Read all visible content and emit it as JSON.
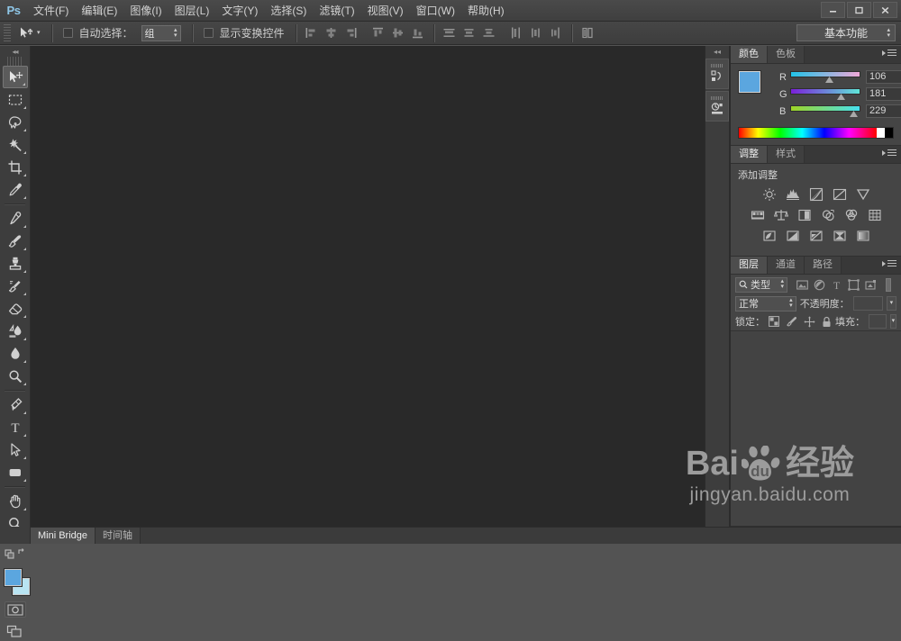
{
  "app": {
    "logo": "Ps",
    "workspace": "基本功能"
  },
  "menubar": {
    "items": [
      {
        "label": "文件(F)",
        "name": "menu-file"
      },
      {
        "label": "编辑(E)",
        "name": "menu-edit"
      },
      {
        "label": "图像(I)",
        "name": "menu-image"
      },
      {
        "label": "图层(L)",
        "name": "menu-layer"
      },
      {
        "label": "文字(Y)",
        "name": "menu-type"
      },
      {
        "label": "选择(S)",
        "name": "menu-select"
      },
      {
        "label": "滤镜(T)",
        "name": "menu-filter"
      },
      {
        "label": "视图(V)",
        "name": "menu-view"
      },
      {
        "label": "窗口(W)",
        "name": "menu-window"
      },
      {
        "label": "帮助(H)",
        "name": "menu-help"
      }
    ],
    "window_controls": {
      "minimize": "—",
      "maximize": "❐",
      "close": "✕"
    }
  },
  "options_bar": {
    "tool_icon": "move-tool-icon",
    "auto_select_label": "自动选择：",
    "auto_select_value": "组",
    "show_transform_label": "显示变换控件",
    "align_group_1": [
      "align-left-edges",
      "align-horizontal-centers",
      "align-right-edges"
    ],
    "align_group_2": [
      "align-top-edges",
      "align-vertical-centers",
      "align-bottom-edges"
    ],
    "distribute_group_1": [
      "distribute-top-edges",
      "distribute-vertical-centers",
      "distribute-bottom-edges"
    ],
    "distribute_group_2": [
      "distribute-left-edges",
      "distribute-horizontal-centers",
      "distribute-right-edges"
    ],
    "auto_align": "auto-align-layers"
  },
  "toolbar": {
    "tools": [
      {
        "name": "move-tool",
        "active": true
      },
      {
        "name": "rectangular-marquee-tool",
        "active": false
      },
      {
        "name": "lasso-tool",
        "active": false
      },
      {
        "name": "magic-wand-tool",
        "active": false
      },
      {
        "name": "crop-tool",
        "active": false
      },
      {
        "name": "eyedropper-tool",
        "active": false
      },
      {
        "name": "spot-healing-brush-tool",
        "active": false
      },
      {
        "name": "brush-tool",
        "active": false
      },
      {
        "name": "clone-stamp-tool",
        "active": false
      },
      {
        "name": "history-brush-tool",
        "active": false
      },
      {
        "name": "eraser-tool",
        "active": false
      },
      {
        "name": "gradient-tool",
        "active": false
      },
      {
        "name": "blur-tool",
        "active": false
      },
      {
        "name": "dodge-tool",
        "active": false
      },
      {
        "name": "pen-tool",
        "active": false
      },
      {
        "name": "horizontal-type-tool",
        "active": false
      },
      {
        "name": "path-selection-tool",
        "active": false
      },
      {
        "name": "rectangle-tool",
        "active": false
      },
      {
        "name": "hand-tool",
        "active": false
      },
      {
        "name": "zoom-tool",
        "active": false
      }
    ],
    "foreground_color": "#5ba6df",
    "background_color": "#b8e4f2",
    "quick_mask": "edit-in-quick-mask-mode",
    "screen_mode": "change-screen-mode"
  },
  "dock": {
    "items": [
      {
        "name": "history-panel-icon"
      },
      {
        "name": "actions-panel-icon"
      }
    ]
  },
  "color_panel": {
    "tabs": [
      {
        "label": "颜色",
        "active": true
      },
      {
        "label": "色板",
        "active": false
      }
    ],
    "foreground_color": "#5ba6df",
    "background_color": "#b8e4f2",
    "channels": [
      {
        "label": "R",
        "value": "106",
        "pos": 43
      },
      {
        "label": "G",
        "value": "181",
        "pos": 71
      },
      {
        "label": "B",
        "value": "229",
        "pos": 90
      }
    ]
  },
  "adjustments_panel": {
    "tabs": [
      {
        "label": "调整",
        "active": true
      },
      {
        "label": "样式",
        "active": false
      }
    ],
    "title": "添加调整",
    "row1": [
      "brightness-contrast-icon",
      "levels-icon",
      "curves-icon",
      "exposure-icon",
      "vibrance-icon"
    ],
    "row2": [
      "hue-saturation-icon",
      "color-balance-icon",
      "black-white-icon",
      "photo-filter-icon",
      "channel-mixer-icon",
      "color-lookup-icon"
    ],
    "row3": [
      "invert-icon",
      "posterize-icon",
      "threshold-icon",
      "selective-color-icon",
      "gradient-map-icon"
    ]
  },
  "layers_panel": {
    "tabs": [
      {
        "label": "图层",
        "active": true
      },
      {
        "label": "通道",
        "active": false
      },
      {
        "label": "路径",
        "active": false
      }
    ],
    "filter_type": "类型",
    "filter_icons": [
      "filter-pixel-icon",
      "filter-adjustment-icon",
      "filter-type-icon",
      "filter-shape-icon",
      "filter-smart-object-icon"
    ],
    "blend_mode": "正常",
    "opacity_label": "不透明度：",
    "opacity_value": "",
    "lock_label": "锁定：",
    "lock_icons": [
      "lock-transparent-pixels-icon",
      "lock-image-pixels-icon",
      "lock-position-icon",
      "lock-all-icon"
    ],
    "fill_label": "填充：",
    "fill_value": ""
  },
  "bottom_bar": {
    "tabs": [
      {
        "label": "Mini Bridge",
        "active": true
      },
      {
        "label": "时间轴",
        "active": false
      }
    ]
  },
  "watermark": {
    "brand_latin": "Bai",
    "brand_du": "du",
    "brand_cn": "经验",
    "url": "jingyan.baidu.com"
  }
}
